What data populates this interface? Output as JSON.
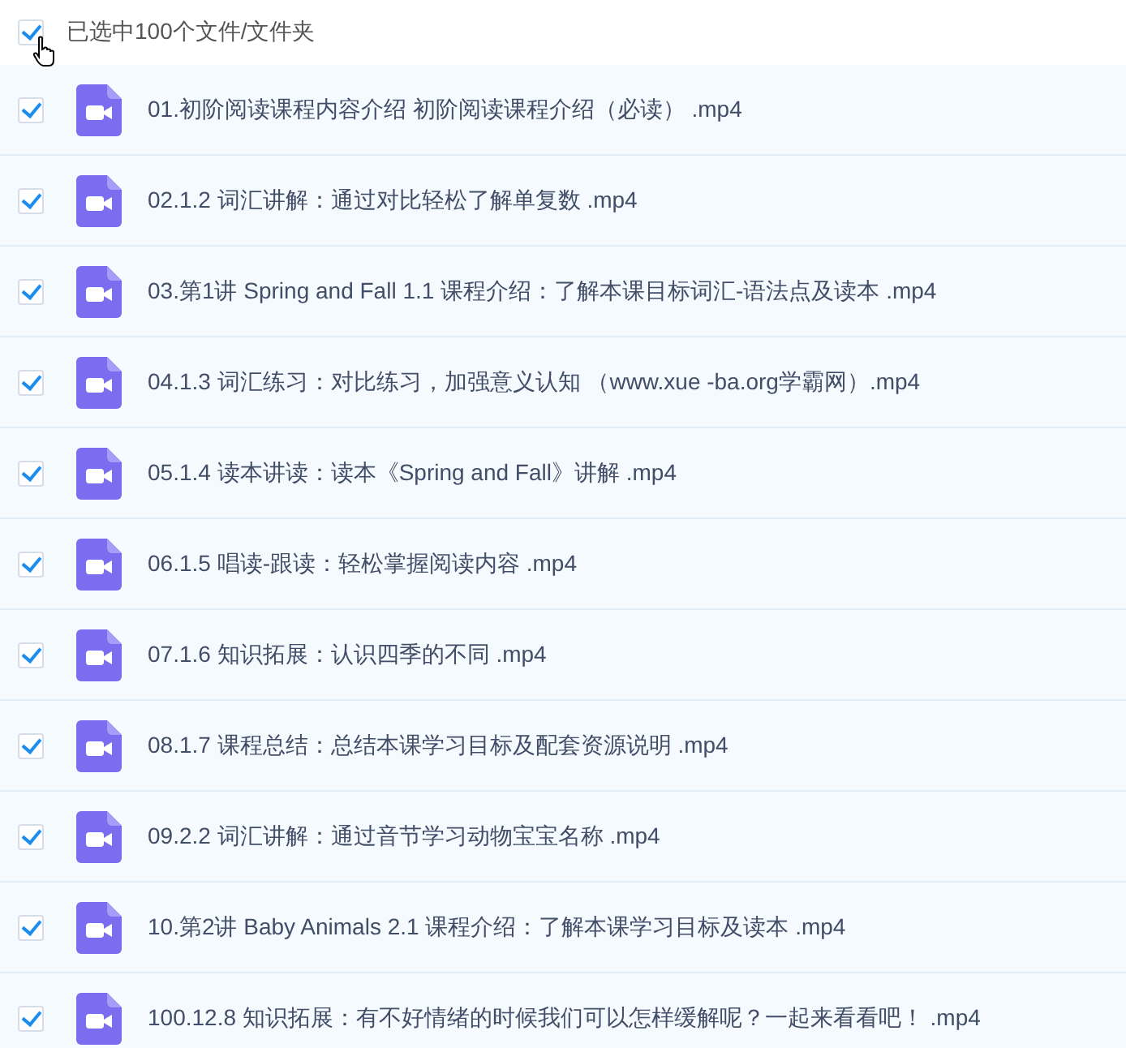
{
  "header": {
    "checked": true,
    "label": "已选中100个文件/文件夹"
  },
  "files": [
    {
      "name": "01.初阶阅读课程内容介绍 初阶阅读课程介绍（必读） .mp4",
      "checked": true
    },
    {
      "name": "02.1.2 词汇讲解：通过对比轻松了解单复数 .mp4",
      "checked": true
    },
    {
      "name": "03.第1讲 Spring and Fall 1.1 课程介绍：了解本课目标词汇-语法点及读本 .mp4",
      "checked": true
    },
    {
      "name": "04.1.3 词汇练习：对比练习，加强意义认知 （www.xue -ba.org学霸网）.mp4",
      "checked": true
    },
    {
      "name": "05.1.4 读本讲读：读本《Spring and Fall》讲解 .mp4",
      "checked": true
    },
    {
      "name": "06.1.5 唱读-跟读：轻松掌握阅读内容 .mp4",
      "checked": true
    },
    {
      "name": "07.1.6 知识拓展：认识四季的不同 .mp4",
      "checked": true
    },
    {
      "name": "08.1.7 课程总结：总结本课学习目标及配套资源说明 .mp4",
      "checked": true
    },
    {
      "name": "09.2.2 词汇讲解：通过音节学习动物宝宝名称 .mp4",
      "checked": true
    },
    {
      "name": "10.第2讲 Baby Animals 2.1 课程介绍：了解本课学习目标及读本 .mp4",
      "checked": true
    },
    {
      "name": "100.12.8 知识拓展：有不好情绪的时候我们可以怎样缓解呢？一起来看看吧！ .mp4",
      "checked": true
    }
  ]
}
